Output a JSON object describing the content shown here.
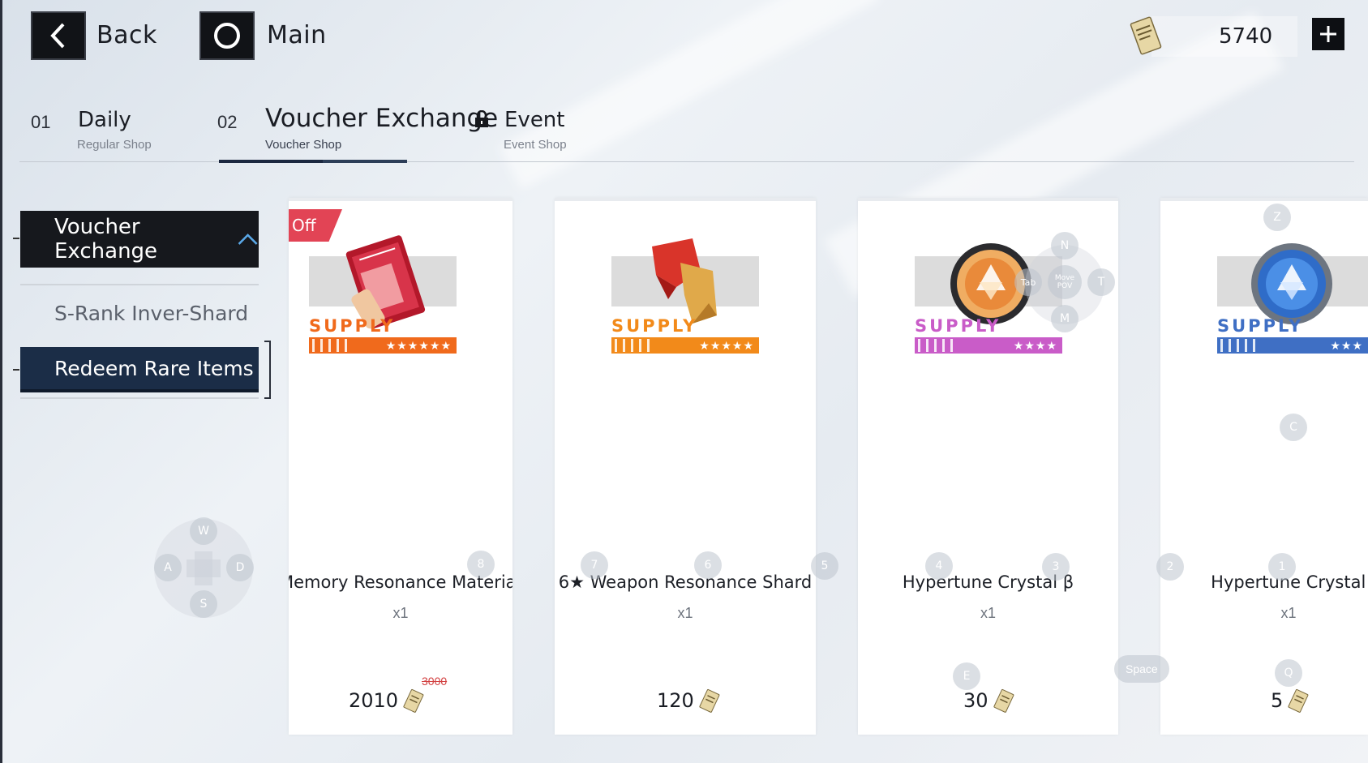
{
  "topbar": {
    "back_label": "Back",
    "main_label": "Main",
    "currency_amount": "5740",
    "icons": {
      "back": "chevron-left-icon",
      "main": "circle-home-icon",
      "currency": "voucher-ticket-icon",
      "plus": "plus-icon"
    }
  },
  "tabs": [
    {
      "num": "01",
      "title": "Daily",
      "subtitle": "Regular Shop",
      "active": false
    },
    {
      "num": "02",
      "title": "Voucher Exchange",
      "subtitle": "Voucher Shop",
      "active": true
    },
    {
      "num": "",
      "title": "Event",
      "subtitle": "Event Shop",
      "active": false,
      "locked": true
    }
  ],
  "sidebar": {
    "header": "Voucher Exchange",
    "items": [
      {
        "label": "S-Rank Inver-Shard",
        "active": false
      },
      {
        "label": "Redeem Rare Items",
        "active": true
      }
    ]
  },
  "cards": [
    {
      "name": "Memory Resonance Material Pick",
      "qty": "x1",
      "price": "2010",
      "old_price": "3000",
      "badge": "Off",
      "supply": "SUPPLY",
      "stars": "★★★★★★",
      "color": "#f06a1c"
    },
    {
      "name": "6★ Weapon Resonance Shard",
      "qty": "x1",
      "price": "120",
      "supply": "SUPPLY",
      "stars": "★★★★★",
      "color": "#f28a1a"
    },
    {
      "name": "Hypertune Crystal β",
      "qty": "x1",
      "price": "30",
      "supply": "SUPPLY",
      "stars": "★★★★",
      "color": "#c95cc8"
    },
    {
      "name": "Hypertune Crystal α",
      "qty": "x1",
      "price": "5",
      "supply": "SUPPLY",
      "stars": "★★★",
      "color": "#3f6fc4"
    }
  ],
  "key_hints": {
    "wasd": [
      "W",
      "A",
      "S",
      "D"
    ],
    "numbers": [
      "8",
      "7",
      "6",
      "5",
      "4",
      "3",
      "2",
      "1"
    ],
    "nav": [
      "N",
      "T",
      "M",
      "Tab"
    ],
    "move_pov": "Move POV",
    "other": [
      "Z",
      "C",
      "E",
      "Q",
      "Space"
    ]
  }
}
